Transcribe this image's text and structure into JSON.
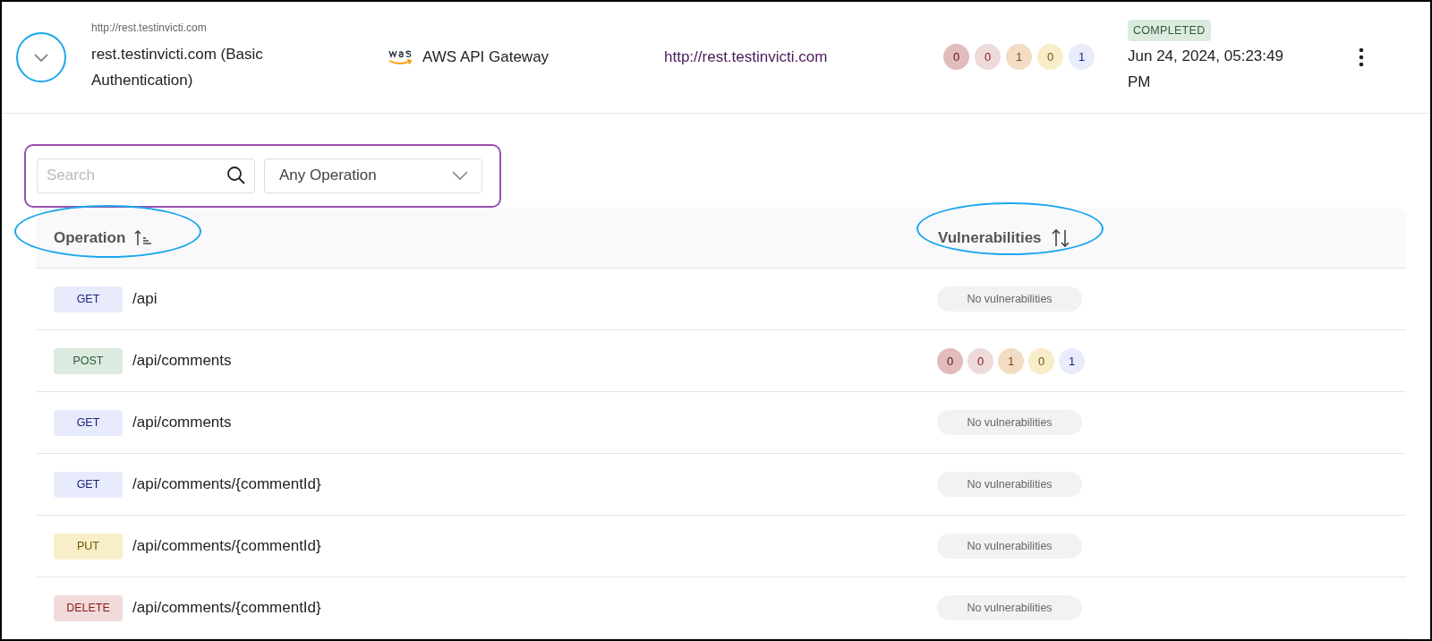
{
  "scan": {
    "url_small": "http://rest.testinvicti.com",
    "title": "rest.testinvicti.com (Basic Authentication)",
    "gateway": "AWS API Gateway",
    "url": "http://rest.testinvicti.com",
    "severity_counts": [
      {
        "value": "0",
        "color": "#e2bcbc"
      },
      {
        "value": "0",
        "color": "#eedada"
      },
      {
        "value": "1",
        "color": "#f3dcc4"
      },
      {
        "value": "0",
        "color": "#f8edc8"
      },
      {
        "value": "1",
        "color": "#e8ecfb"
      }
    ],
    "status": "COMPLETED",
    "date": "Jun 24, 2024, 05:23:49 PM",
    "expanded": true
  },
  "filters": {
    "search": {
      "placeholder": "Search"
    },
    "operation_select": {
      "value": "Any Operation"
    }
  },
  "table": {
    "columns": [
      {
        "label": "Operation",
        "sorted": true
      },
      {
        "label": "Vulnerabilities",
        "sorted": false
      }
    ],
    "rows": [
      {
        "method": "GET",
        "path": "/api",
        "vulnerabilities": {
          "kind": "none",
          "label": "No vulnerabilities"
        }
      },
      {
        "method": "POST",
        "path": "/api/comments",
        "vulnerabilities": {
          "kind": "counts",
          "counts": [
            {
              "value": "0",
              "color": "#e2bcbc"
            },
            {
              "value": "0",
              "color": "#eedada"
            },
            {
              "value": "1",
              "color": "#f3dcc4"
            },
            {
              "value": "0",
              "color": "#f8edc8"
            },
            {
              "value": "1",
              "color": "#e8ecfb"
            }
          ]
        }
      },
      {
        "method": "GET",
        "path": "/api/comments",
        "vulnerabilities": {
          "kind": "none",
          "label": "No vulnerabilities"
        }
      },
      {
        "method": "GET",
        "path": "/api/comments/{commentId}",
        "vulnerabilities": {
          "kind": "none",
          "label": "No vulnerabilities"
        }
      },
      {
        "method": "PUT",
        "path": "/api/comments/{commentId}",
        "vulnerabilities": {
          "kind": "none",
          "label": "No vulnerabilities"
        }
      },
      {
        "method": "DELETE",
        "path": "/api/comments/{commentId}",
        "vulnerabilities": {
          "kind": "none",
          "label": "No vulnerabilities"
        }
      }
    ]
  }
}
